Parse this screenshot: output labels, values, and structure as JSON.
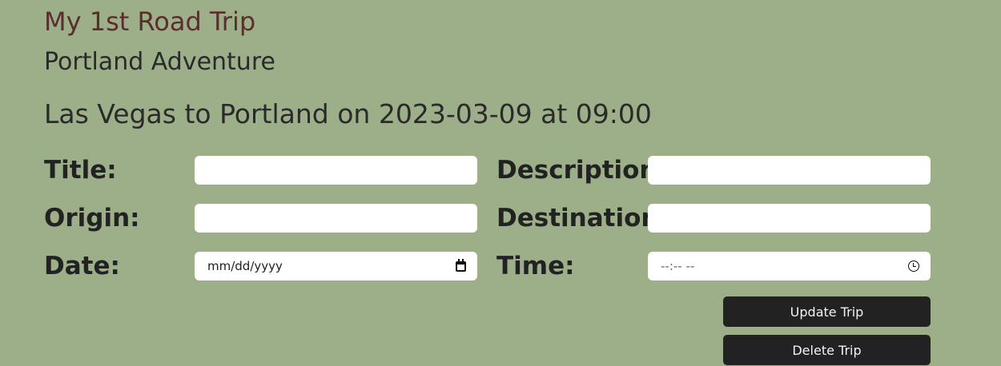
{
  "header": {
    "app_title": "My 1st Road Trip",
    "trip_title": "Portland Adventure",
    "trip_summary": "Las Vegas to Portland on 2023-03-09 at 09:00"
  },
  "form": {
    "title_label": "Title:",
    "title_value": "",
    "description_label": "Description:",
    "description_value": "",
    "origin_label": "Origin:",
    "origin_value": "",
    "destination_label": "Destination:",
    "destination_value": "",
    "date_label": "Date:",
    "date_placeholder": "mm/dd/yyyy",
    "time_label": "Time:",
    "time_placeholder": "--:-- --"
  },
  "actions": {
    "update_label": "Update Trip",
    "delete_label": "Delete Trip"
  },
  "colors": {
    "background": "#9caf88",
    "app_title": "#5a2e2e",
    "button_bg": "#222222"
  },
  "icons": {
    "date": "calendar-icon",
    "time": "clock-icon"
  }
}
